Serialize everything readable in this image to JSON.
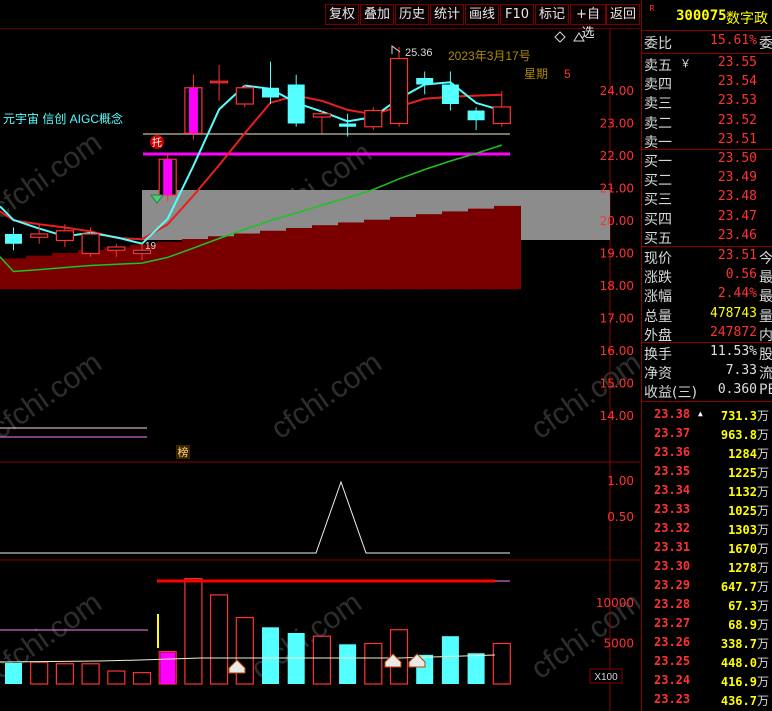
{
  "toolbar": {
    "buttons": [
      "复权",
      "叠加",
      "历史",
      "统计",
      "画线",
      "F10",
      "标记",
      "+自选",
      "返回"
    ]
  },
  "stock": {
    "marker": "R",
    "code": "300075",
    "name": "数字政"
  },
  "chart": {
    "concept_label": "元宇宙 信创 AIGC概念",
    "date_label": "2023年3月17号",
    "weekday_label": "星期",
    "weekday_value": "5",
    "high_label": "25.36",
    "left_label": "19",
    "tuo_badge": "托",
    "bang_badge": "榜",
    "vol_unit": "X100",
    "price_axis": [
      "24.00",
      "23.00",
      "22.00",
      "21.00",
      "20.00",
      "19.00",
      "18.00",
      "17.00",
      "16.00",
      "15.00",
      "14.00"
    ],
    "indicator_axis": [
      "1.00",
      "0.50"
    ],
    "volume_axis": [
      "10000",
      "5000"
    ],
    "colors": {
      "up": "#ff3232",
      "down": "#54ffff",
      "ma_short": "#54ffff",
      "ma_long": "#e8201c",
      "ma_green": "#1ec31e",
      "magenta": "#ff00ff"
    }
  },
  "chart_data": {
    "type": "candlestick",
    "candles": [
      {
        "o": 19.6,
        "c": 19.3,
        "h": 19.8,
        "l": 19.1
      },
      {
        "o": 19.5,
        "c": 19.6,
        "h": 19.9,
        "l": 19.3
      },
      {
        "o": 19.4,
        "c": 19.7,
        "h": 19.9,
        "l": 19.2
      },
      {
        "o": 19.0,
        "c": 19.6,
        "h": 19.8,
        "l": 18.9
      },
      {
        "o": 19.1,
        "c": 19.2,
        "h": 19.3,
        "l": 18.9
      },
      {
        "o": 19.0,
        "c": 19.1,
        "h": 19.3,
        "l": 18.8
      },
      {
        "o": 20.8,
        "c": 21.9,
        "h": 22.1,
        "l": 20.6
      },
      {
        "o": 22.7,
        "c": 24.1,
        "h": 24.5,
        "l": 22.5
      },
      {
        "o": 24.3,
        "c": 24.3,
        "h": 24.8,
        "l": 23.7
      },
      {
        "o": 23.6,
        "c": 24.1,
        "h": 24.2,
        "l": 23.5
      },
      {
        "o": 24.1,
        "c": 23.8,
        "h": 24.9,
        "l": 23.6
      },
      {
        "o": 24.2,
        "c": 23.0,
        "h": 24.5,
        "l": 22.9
      },
      {
        "o": 23.2,
        "c": 23.3,
        "h": 23.4,
        "l": 22.7
      },
      {
        "o": 23.0,
        "c": 22.9,
        "h": 23.3,
        "l": 22.6
      },
      {
        "o": 22.9,
        "c": 23.4,
        "h": 23.5,
        "l": 22.8
      },
      {
        "o": 23.0,
        "c": 25.0,
        "h": 25.36,
        "l": 22.9
      },
      {
        "o": 24.4,
        "c": 24.2,
        "h": 24.6,
        "l": 23.9
      },
      {
        "o": 24.2,
        "c": 23.6,
        "h": 24.6,
        "l": 23.4
      },
      {
        "o": 23.4,
        "c": 23.1,
        "h": 23.5,
        "l": 22.8
      },
      {
        "o": 23.0,
        "c": 23.51,
        "h": 24.0,
        "l": 22.9
      }
    ],
    "volume": [
      2600,
      2700,
      2500,
      2500,
      1600,
      1400,
      4000,
      13000,
      11000,
      8200,
      7000,
      6300,
      5900,
      4900,
      5000,
      6700,
      3600,
      5900,
      3800,
      5000
    ]
  },
  "quote": {
    "weibi": {
      "label": "委比",
      "value": "15.61%",
      "cut": "委"
    },
    "asks": [
      {
        "label": "卖五",
        "mark": "￥",
        "price": "23.55"
      },
      {
        "label": "卖四",
        "price": "23.54"
      },
      {
        "label": "卖三",
        "price": "23.53"
      },
      {
        "label": "卖二",
        "price": "23.52"
      },
      {
        "label": "卖一",
        "price": "23.51"
      }
    ],
    "bids": [
      {
        "label": "买一",
        "price": "23.50"
      },
      {
        "label": "买二",
        "price": "23.49"
      },
      {
        "label": "买三",
        "price": "23.48"
      },
      {
        "label": "买四",
        "price": "23.47"
      },
      {
        "label": "买五",
        "price": "23.46"
      }
    ],
    "stats1": [
      {
        "label": "现价",
        "value": "23.51",
        "cut": "今"
      },
      {
        "label": "涨跌",
        "value": "0.56",
        "cut": "最"
      },
      {
        "label": "涨幅",
        "value": "2.44%",
        "cut": "最"
      },
      {
        "label": "总量",
        "value": "478743",
        "cut": "量"
      },
      {
        "label": "外盘",
        "value": "247872",
        "cut": "内"
      }
    ],
    "stats2": [
      {
        "label": "换手",
        "value": "11.53%",
        "cut": "股"
      },
      {
        "label": "净资",
        "value": "7.33",
        "cut": "流"
      },
      {
        "label": "收益(三)",
        "value": "0.360",
        "cut": "PE"
      }
    ],
    "tick_marker": "▲",
    "ticks": [
      {
        "price": "23.38",
        "vol": "731.3",
        "unit": "万"
      },
      {
        "price": "23.37",
        "vol": "963.8",
        "unit": "万"
      },
      {
        "price": "23.36",
        "vol": "1284",
        "unit": "万"
      },
      {
        "price": "23.35",
        "vol": "1225",
        "unit": "万"
      },
      {
        "price": "23.34",
        "vol": "1132",
        "unit": "万"
      },
      {
        "price": "23.33",
        "vol": "1025",
        "unit": "万"
      },
      {
        "price": "23.32",
        "vol": "1303",
        "unit": "万"
      },
      {
        "price": "23.31",
        "vol": "1670",
        "unit": "万"
      },
      {
        "price": "23.30",
        "vol": "1278",
        "unit": "万"
      },
      {
        "price": "23.29",
        "vol": "647.7",
        "unit": "万"
      },
      {
        "price": "23.28",
        "vol": "67.3",
        "unit": "万"
      },
      {
        "price": "23.27",
        "vol": "68.9",
        "unit": "万"
      },
      {
        "price": "23.26",
        "vol": "338.7",
        "unit": "万"
      },
      {
        "price": "23.25",
        "vol": "448.0",
        "unit": "万"
      },
      {
        "price": "23.24",
        "vol": "416.9",
        "unit": "万"
      },
      {
        "price": "23.23",
        "vol": "436.7",
        "unit": "万"
      }
    ]
  }
}
